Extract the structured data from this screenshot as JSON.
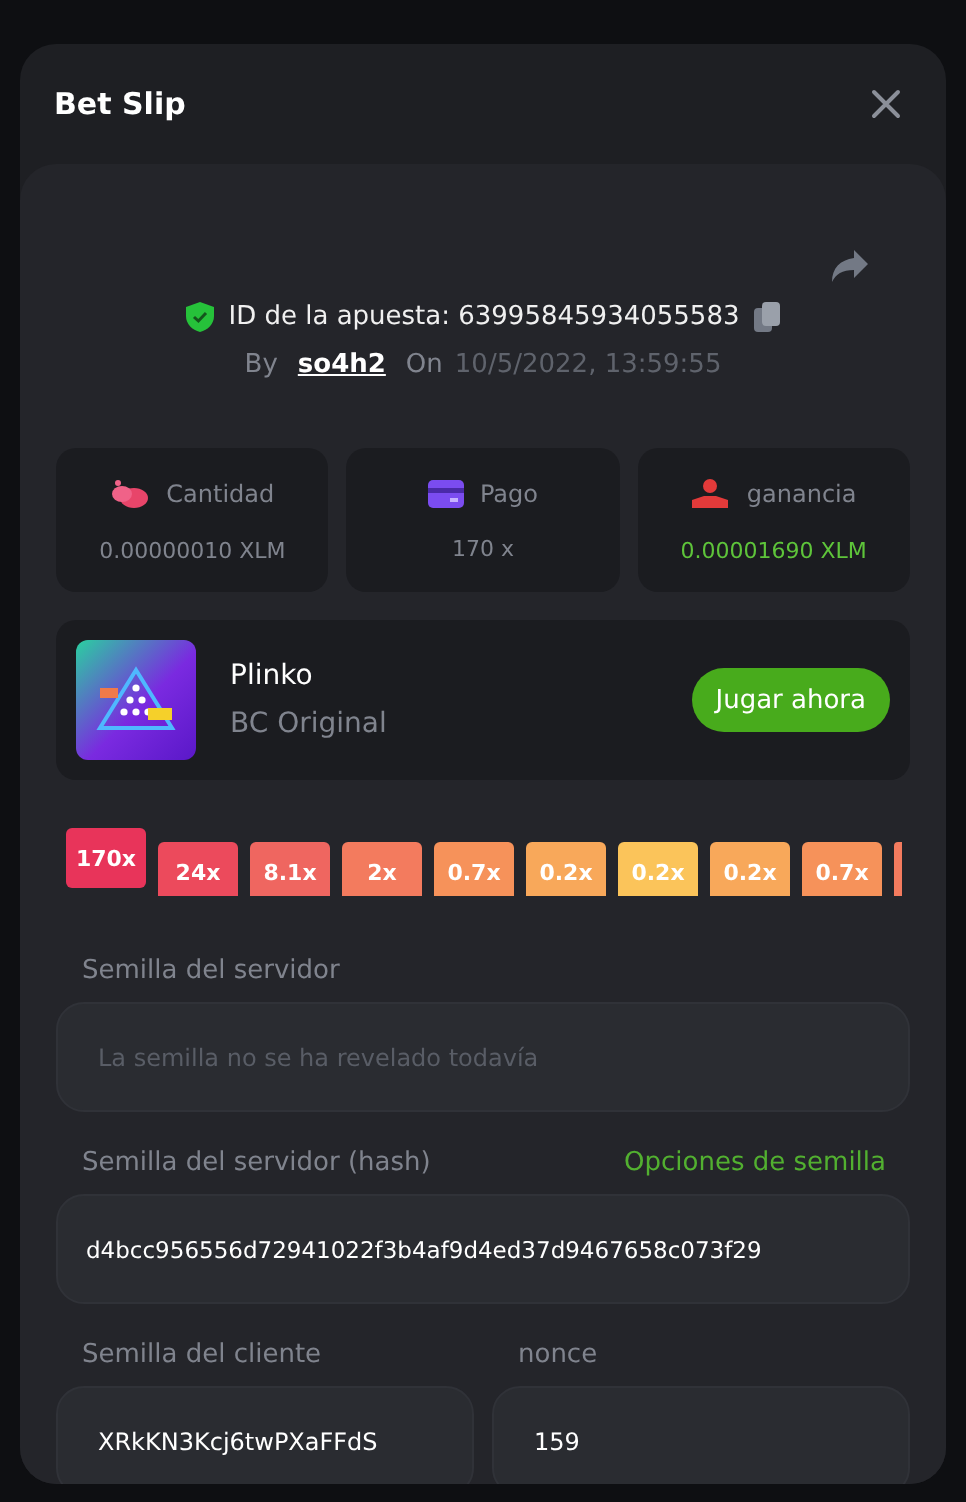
{
  "modal": {
    "title": "Bet Slip"
  },
  "bet": {
    "id_label": "ID de la apuesta: 63995845934055583",
    "by_label": "By",
    "user": "so4h2",
    "on_label": "On",
    "date": "10/5/2022, 13:59:55"
  },
  "stats": [
    {
      "kind": "amount",
      "label": "Cantidad",
      "value": "0.00000010 XLM",
      "positive": false
    },
    {
      "kind": "payout",
      "label": "Pago",
      "value": "170 x",
      "positive": false
    },
    {
      "kind": "profit",
      "label": "ganancia",
      "value": "0.00001690 XLM",
      "positive": true
    }
  ],
  "game": {
    "name": "Plinko",
    "provider": "BC Original",
    "play_button": "Jugar ahora"
  },
  "multipliers": [
    {
      "label": "170x",
      "color": "#e8345a",
      "selected": true
    },
    {
      "label": "24x",
      "color": "#ec4a5c",
      "selected": false
    },
    {
      "label": "8.1x",
      "color": "#ef6660",
      "selected": false
    },
    {
      "label": "2x",
      "color": "#f37b5e",
      "selected": false
    },
    {
      "label": "0.7x",
      "color": "#f6925a",
      "selected": false
    },
    {
      "label": "0.2x",
      "color": "#f8a85a",
      "selected": false
    },
    {
      "label": "0.2x",
      "color": "#fbc45a",
      "selected": false
    },
    {
      "label": "0.2x",
      "color": "#f8a85a",
      "selected": false
    },
    {
      "label": "0.7x",
      "color": "#f6925a",
      "selected": false
    }
  ],
  "server_seed": {
    "label": "Semilla del servidor",
    "placeholder": "La semilla no se ha revelado todavía"
  },
  "server_hash": {
    "label": "Semilla del servidor (hash)",
    "link": "Opciones de semilla",
    "value": "d4bcc956556d72941022f3b4af9d4ed37d9467658c073f29"
  },
  "client_seed": {
    "label": "Semilla del cliente",
    "value": "XRkKN3Kcj6twPXaFFdS"
  },
  "nonce": {
    "label": "nonce",
    "value": "159"
  }
}
